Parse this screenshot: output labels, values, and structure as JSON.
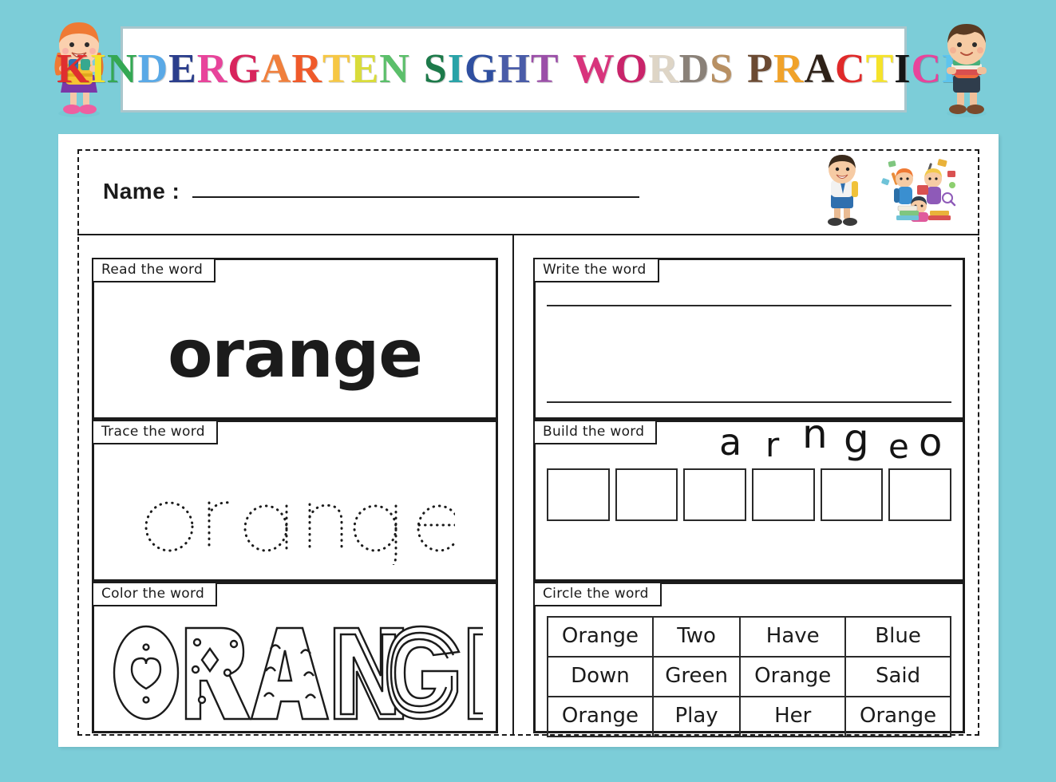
{
  "theme": {
    "background": "#7ccdd8",
    "page_background": "#ffffff",
    "ink": "#1b1b1b",
    "title_border": "#a9c6cc"
  },
  "header": {
    "title": "KINDERGARTEN SIGHT WORDS PRACTICE",
    "title_letters": [
      {
        "ch": "K",
        "color": "#e02f2f"
      },
      {
        "ch": "I",
        "color": "#f5e32a"
      },
      {
        "ch": "N",
        "color": "#34a853"
      },
      {
        "ch": "D",
        "color": "#5aa9e6"
      },
      {
        "ch": "E",
        "color": "#2b3e8c"
      },
      {
        "ch": "R",
        "color": "#e8449b"
      },
      {
        "ch": "G",
        "color": "#d8245c"
      },
      {
        "ch": "A",
        "color": "#f07f3c"
      },
      {
        "ch": "R",
        "color": "#ef5a2a"
      },
      {
        "ch": "T",
        "color": "#f6c744"
      },
      {
        "ch": "E",
        "color": "#d9dc3a"
      },
      {
        "ch": "N",
        "color": "#5bbf6a"
      },
      {
        "ch": " ",
        "color": "transparent"
      },
      {
        "ch": "S",
        "color": "#1d7a4a"
      },
      {
        "ch": "I",
        "color": "#2aa3a8"
      },
      {
        "ch": "G",
        "color": "#2f4fa0"
      },
      {
        "ch": "H",
        "color": "#4a5ca8"
      },
      {
        "ch": "T",
        "color": "#9b4fa8"
      },
      {
        "ch": " ",
        "color": "transparent"
      },
      {
        "ch": "W",
        "color": "#d8347c"
      },
      {
        "ch": "O",
        "color": "#c9246a"
      },
      {
        "ch": "R",
        "color": "#ded5c6"
      },
      {
        "ch": "D",
        "color": "#8a8178"
      },
      {
        "ch": "S",
        "color": "#b89063"
      },
      {
        "ch": " ",
        "color": "transparent"
      },
      {
        "ch": "P",
        "color": "#6b4a32"
      },
      {
        "ch": "R",
        "color": "#f0a22a"
      },
      {
        "ch": "A",
        "color": "#2e2118"
      },
      {
        "ch": "C",
        "color": "#e02a2a"
      },
      {
        "ch": "T",
        "color": "#f5e32a"
      },
      {
        "ch": "I",
        "color": "#151515"
      },
      {
        "ch": "C",
        "color": "#e8449b"
      },
      {
        "ch": "E",
        "color": "#5ec4ee"
      }
    ],
    "mascot_left": "girl-with-backpack-illustration",
    "mascot_right": "boy-with-books-illustration"
  },
  "name_row": {
    "label": "Name :",
    "line_value": "",
    "art_boy": "schoolboy-illustration",
    "art_group": "kids-with-school-supplies-illustration"
  },
  "word": "orange",
  "sections": {
    "read": {
      "tag": "Read the word",
      "word": "orange"
    },
    "trace": {
      "tag": "Trace the word",
      "word": "orange"
    },
    "color": {
      "tag": "Color the word",
      "word": "ORANGE"
    },
    "write": {
      "tag": "Write the word",
      "value": ""
    },
    "build": {
      "tag": "Build the word",
      "scrambled_letters": [
        "a",
        "r",
        "n",
        "g",
        "e",
        "o"
      ],
      "box_count": 6,
      "box_values": [
        "",
        "",
        "",
        "",
        "",
        ""
      ]
    },
    "circle": {
      "tag": "Circle the word",
      "rows": [
        [
          "Orange",
          "Two",
          "Have",
          "Blue"
        ],
        [
          "Down",
          "Green",
          "Orange",
          "Said"
        ],
        [
          "Orange",
          "Play",
          "Her",
          "Orange"
        ]
      ]
    }
  }
}
